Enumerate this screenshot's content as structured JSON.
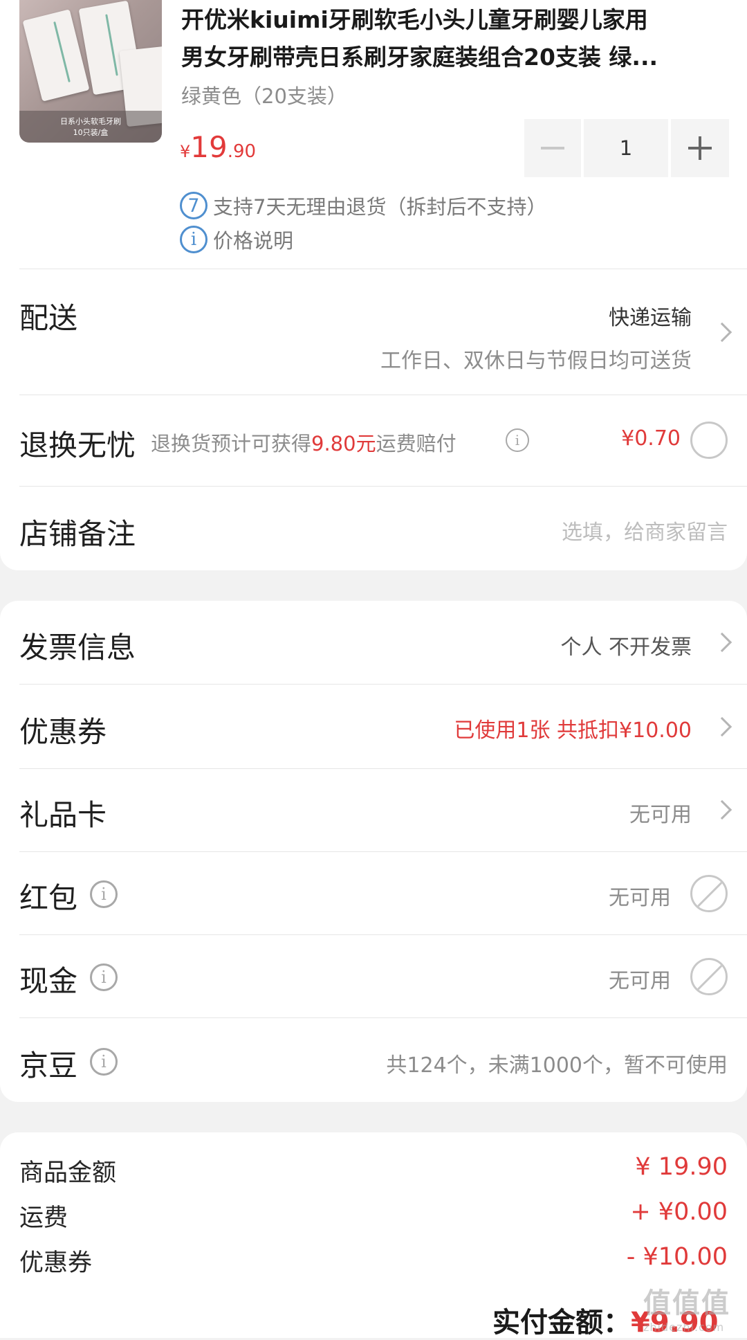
{
  "product": {
    "title_line1": "开优米kiuimi牙刷软毛小头儿童牙刷婴儿家用",
    "title_line2": "男女牙刷带壳日系刷牙家庭装组合20支装 绿...",
    "variant": "绿黄色（20支装）",
    "price_symbol": "¥",
    "price_int": "19",
    "price_dec": ".90",
    "quantity": "1",
    "thumb_caption_1": "日系小头软毛牙刷",
    "thumb_caption_2": "10只装/盒",
    "return_badge": "7",
    "return_note": "支持7天无理由退货（拆封后不支持）",
    "price_note_icon": "i",
    "price_note": "价格说明"
  },
  "delivery": {
    "label": "配送",
    "method": "快递运输",
    "desc": "工作日、双休日与节假日均可送货"
  },
  "return_insurance": {
    "label": "退换无忧",
    "desc_prefix": "退换货预计可获得",
    "desc_amount": "9.80元",
    "desc_suffix": "运费赔付",
    "price": "¥0.70"
  },
  "shop_note": {
    "label": "店铺备注",
    "placeholder": "选填，给商家留言"
  },
  "invoice": {
    "label": "发票信息",
    "value": "个人 不开发票"
  },
  "coupon": {
    "label": "优惠券",
    "value": "已使用1张 共抵扣¥10.00"
  },
  "gift_card": {
    "label": "礼品卡",
    "value": "无可用"
  },
  "red_packet": {
    "label": "红包",
    "value": "无可用"
  },
  "cash": {
    "label": "现金",
    "value": "无可用"
  },
  "jingdou": {
    "label": "京豆",
    "value": "共124个，未满1000个，暂不可使用"
  },
  "summary": {
    "goods_label": "商品金额",
    "goods_value": "¥ 19.90",
    "shipping_label": "运费",
    "shipping_value": "+ ¥0.00",
    "coupon_label": "优惠券",
    "coupon_value": "- ¥10.00",
    "total_label": "实付金额：",
    "total_value": "¥9.90"
  },
  "watermark": {
    "main": "值值值",
    "sub": "zhidezhi.com"
  },
  "icons": {
    "info": "info-circle-icon",
    "chevron": "chevron-right-icon",
    "radio": "radio-circle-icon",
    "unavailable": "prohibited-icon"
  },
  "colors": {
    "accent_red": "#e03a3a",
    "info_blue": "#4f8fcf",
    "background": "#f2f2f2"
  }
}
